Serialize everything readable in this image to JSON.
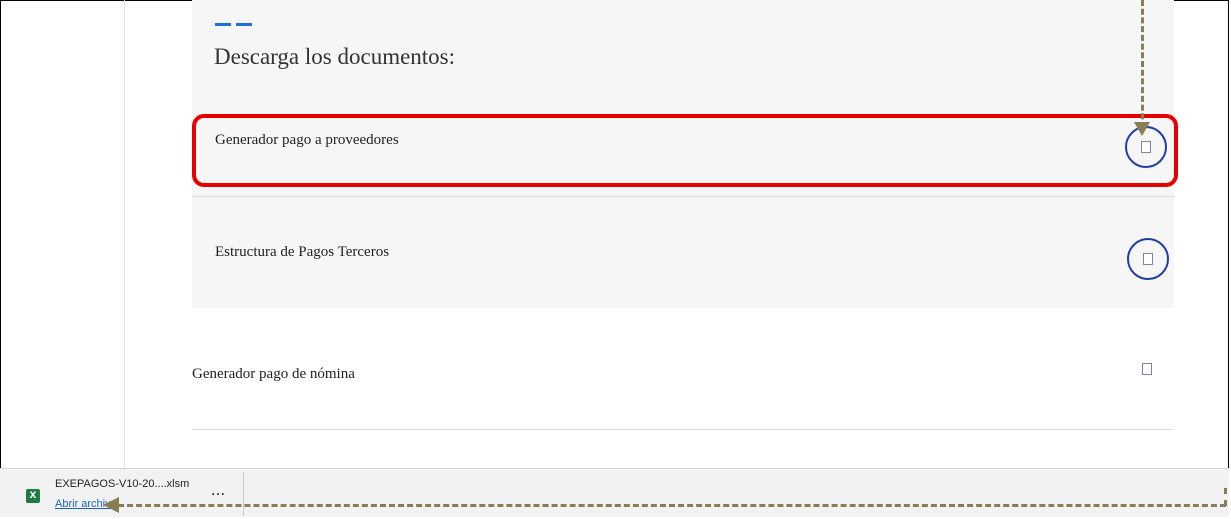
{
  "section": {
    "heading": "Descarga los documentos:",
    "accent_color": "#1d6fe0"
  },
  "documents": [
    {
      "label": "Generador pago a proveedores",
      "download_icon": "download-icon",
      "highlighted": true
    },
    {
      "label": "Estructura de Pagos Terceros",
      "download_icon": "download-icon",
      "highlighted": false
    },
    {
      "label": "Generador pago de nómina",
      "download_icon": "download-icon",
      "highlighted": false
    }
  ],
  "download_bar": {
    "file_name": "EXEPAGOS-V10-20....xlsm",
    "open_label": "Abrir archivo",
    "more_label": "...",
    "file_icon": "excel-file-icon",
    "file_icon_letter": "X"
  },
  "annotations": {
    "highlight_color": "#e60000",
    "arrow_color": "#8b7d52"
  }
}
